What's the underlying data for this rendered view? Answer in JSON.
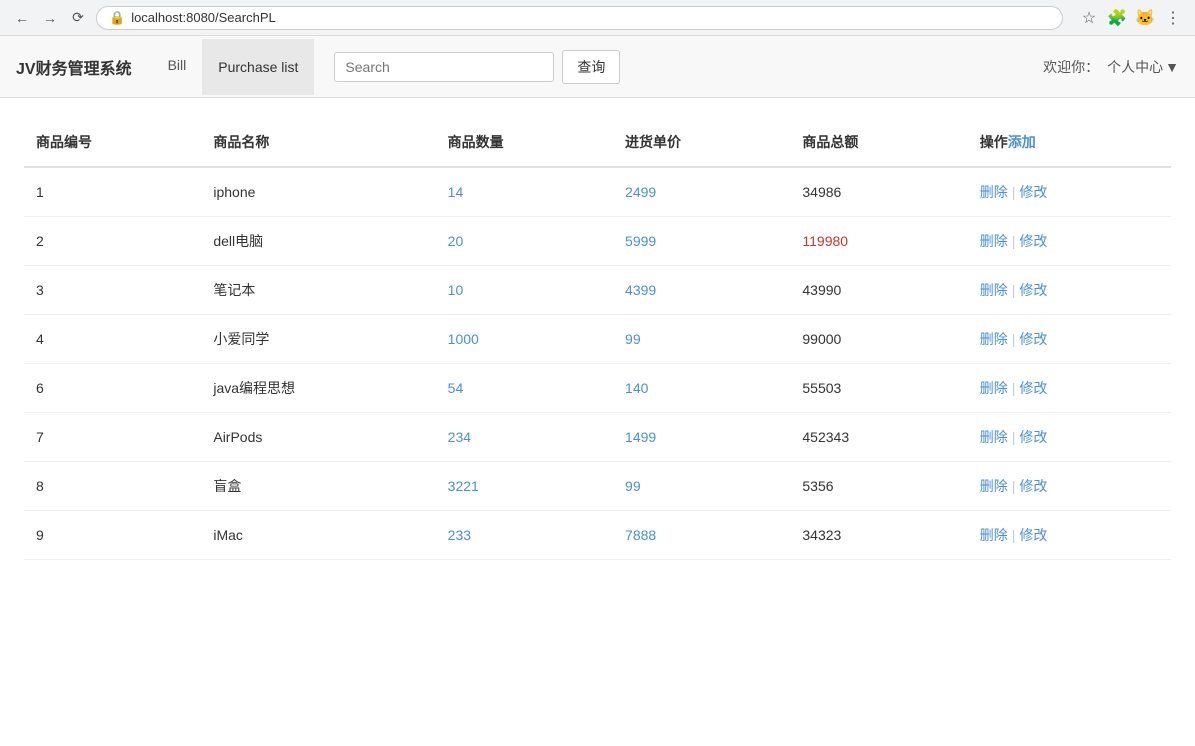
{
  "browser": {
    "url": "localhost:8080/SearchPL"
  },
  "navbar": {
    "brand": "JV财务管理系统",
    "tabs": [
      {
        "label": "Bill",
        "active": false
      },
      {
        "label": "Purchase list",
        "active": true
      }
    ],
    "search_placeholder": "Search",
    "search_btn_label": "查询",
    "welcome_label": "欢迎你：",
    "user_menu_label": "个人中心"
  },
  "table": {
    "columns": [
      {
        "key": "id",
        "label": "商品编号"
      },
      {
        "key": "name",
        "label": "商品名称"
      },
      {
        "key": "qty",
        "label": "商品数量"
      },
      {
        "key": "unit_price",
        "label": "进货单价"
      },
      {
        "key": "total",
        "label": "商品总额"
      },
      {
        "key": "ops",
        "label": "操作",
        "add_label": "添加"
      }
    ],
    "rows": [
      {
        "id": "1",
        "name": "iphone",
        "qty": "14",
        "unit_price": "2499",
        "total": "34986",
        "total_highlight": false
      },
      {
        "id": "2",
        "name": "dell电脑",
        "qty": "20",
        "unit_price": "5999",
        "total": "119980",
        "total_highlight": true
      },
      {
        "id": "3",
        "name": "笔记本",
        "qty": "10",
        "unit_price": "4399",
        "total": "43990",
        "total_highlight": false
      },
      {
        "id": "4",
        "name": "小爱同学",
        "qty": "1000",
        "unit_price": "99",
        "total": "99000",
        "total_highlight": false
      },
      {
        "id": "6",
        "name": "java编程思想",
        "qty": "54",
        "unit_price": "140",
        "total": "55503",
        "total_highlight": false
      },
      {
        "id": "7",
        "name": "AirPods",
        "qty": "234",
        "unit_price": "1499",
        "total": "452343",
        "total_highlight": false
      },
      {
        "id": "8",
        "name": "盲盒",
        "qty": "3221",
        "unit_price": "99",
        "total": "5356",
        "total_highlight": false
      },
      {
        "id": "9",
        "name": "iMac",
        "qty": "233",
        "unit_price": "7888",
        "total": "34323",
        "total_highlight": false
      }
    ],
    "delete_label": "删除",
    "edit_label": "修改"
  }
}
